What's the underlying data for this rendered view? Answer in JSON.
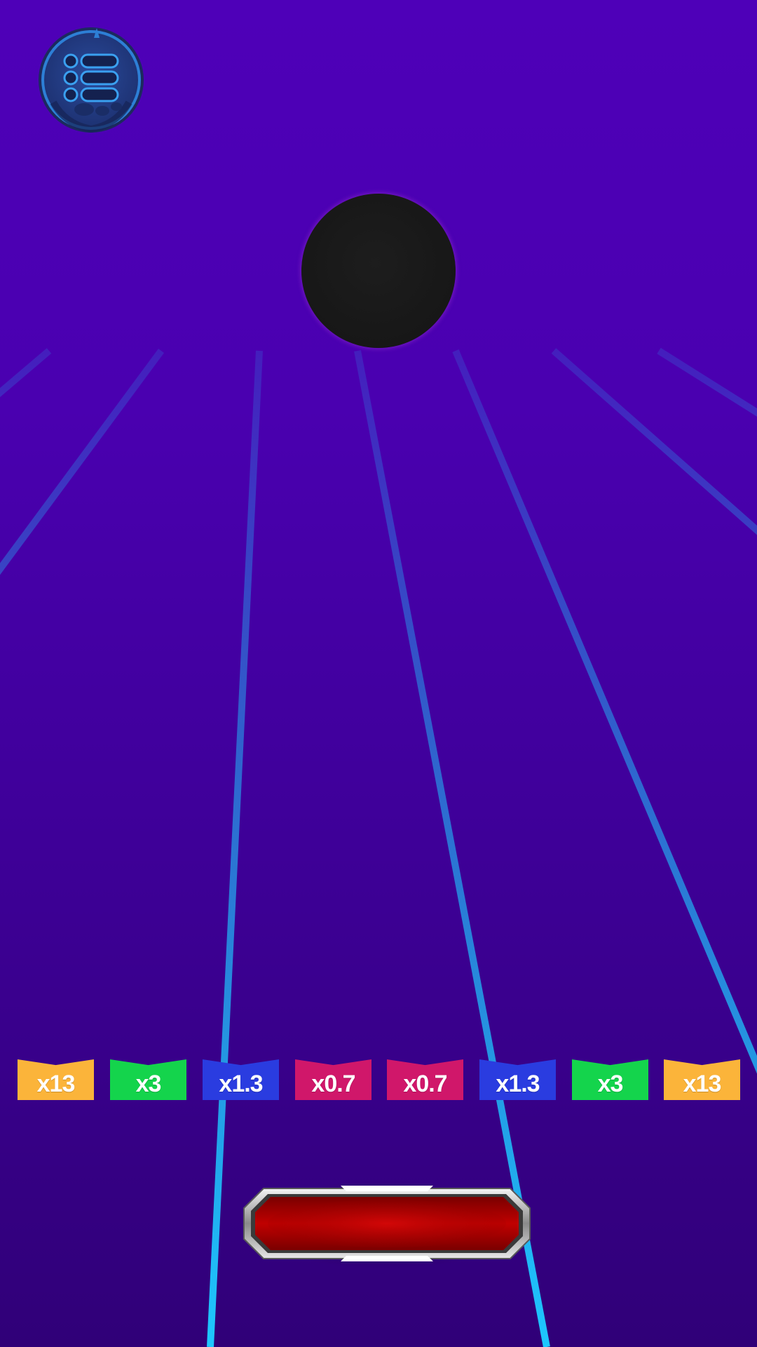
{
  "colors": {
    "background_top": "#4e00b8",
    "background_bottom": "#300078",
    "grid_line": "#1ec8ff",
    "ball": "#1a1a1a",
    "button_red": "#b00000",
    "button_frame": "#d8d8d8"
  },
  "menu": {
    "icon": "menu-list-icon"
  },
  "ball": {
    "icon": "black-ball"
  },
  "multipliers": [
    {
      "label": "x13",
      "color": "#fbb43a"
    },
    {
      "label": "x3",
      "color": "#14d44c"
    },
    {
      "label": "x1.3",
      "color": "#2a3ce0"
    },
    {
      "label": "x0.7",
      "color": "#d0176a"
    },
    {
      "label": "x0.7",
      "color": "#d0176a"
    },
    {
      "label": "x1.3",
      "color": "#2a3ce0"
    },
    {
      "label": "x3",
      "color": "#14d44c"
    },
    {
      "label": "x13",
      "color": "#fbb43a"
    }
  ],
  "drop_button": {
    "label": ""
  }
}
